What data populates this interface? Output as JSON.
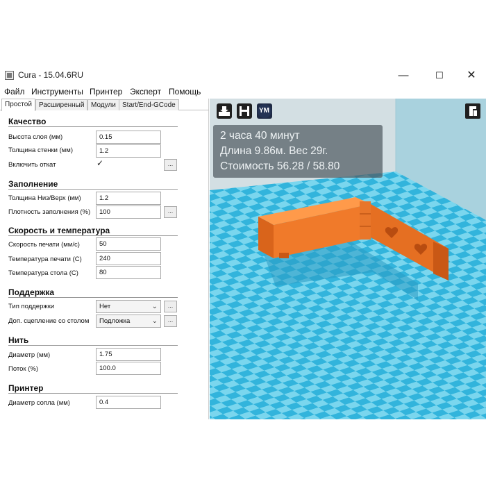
{
  "window": {
    "title": "Cura - 15.04.6RU",
    "minimize": "—",
    "maximize": "☐",
    "close": "✕"
  },
  "menu": [
    "Файл",
    "Инструменты",
    "Принтер",
    "Эксперт",
    "Помощь"
  ],
  "tabs": [
    "Простой",
    "Расширенный",
    "Модули",
    "Start/End-GCode"
  ],
  "active_tab": "Простой",
  "sections": {
    "quality": {
      "title": "Качество",
      "layer_height_label": "Высота слоя (мм)",
      "layer_height": "0.15",
      "wall_thickness_label": "Толщина стенки (мм)",
      "wall_thickness": "1.2",
      "retraction_label": "Включить откат",
      "retraction_checked": "✓"
    },
    "fill": {
      "title": "Заполнение",
      "bottom_top_label": "Толщина Низ/Верх (мм)",
      "bottom_top": "1.2",
      "density_label": "Плотность заполнения (%)",
      "density": "100"
    },
    "speed": {
      "title": "Скорость и температура",
      "print_speed_label": "Скорость печати (мм/с)",
      "print_speed": "50",
      "print_temp_label": "Температура печати (C)",
      "print_temp": "240",
      "bed_temp_label": "Температура стола (C)",
      "bed_temp": "80"
    },
    "support": {
      "title": "Поддержка",
      "support_type_label": "Тип поддержки",
      "support_type": "Нет",
      "adhesion_label": "Доп. сцепление со столом",
      "adhesion": "Подложка"
    },
    "filament": {
      "title": "Нить",
      "diameter_label": "Диаметр (мм)",
      "diameter": "1.75",
      "flow_label": "Поток (%)",
      "flow": "100.0"
    },
    "printer": {
      "title": "Принтер",
      "nozzle_label": "Диаметр сопла (мм)",
      "nozzle": "0.4"
    }
  },
  "ellipsis": "...",
  "viewport": {
    "toolbar": {
      "load_icon": "load-model-icon",
      "save_icon": "save-icon",
      "ym_label": "YM",
      "view_mode_icon": "view-mode-icon"
    },
    "info": {
      "time": "2 часа 40 минут",
      "length_weight": "Длина 9.86м. Вес 29г.",
      "cost": "Стоимость 56.28 / 58.80"
    },
    "colors": {
      "bed_light": "#7ad6ee",
      "bed_dark": "#32b4dc",
      "model": "#f07a2a"
    }
  }
}
